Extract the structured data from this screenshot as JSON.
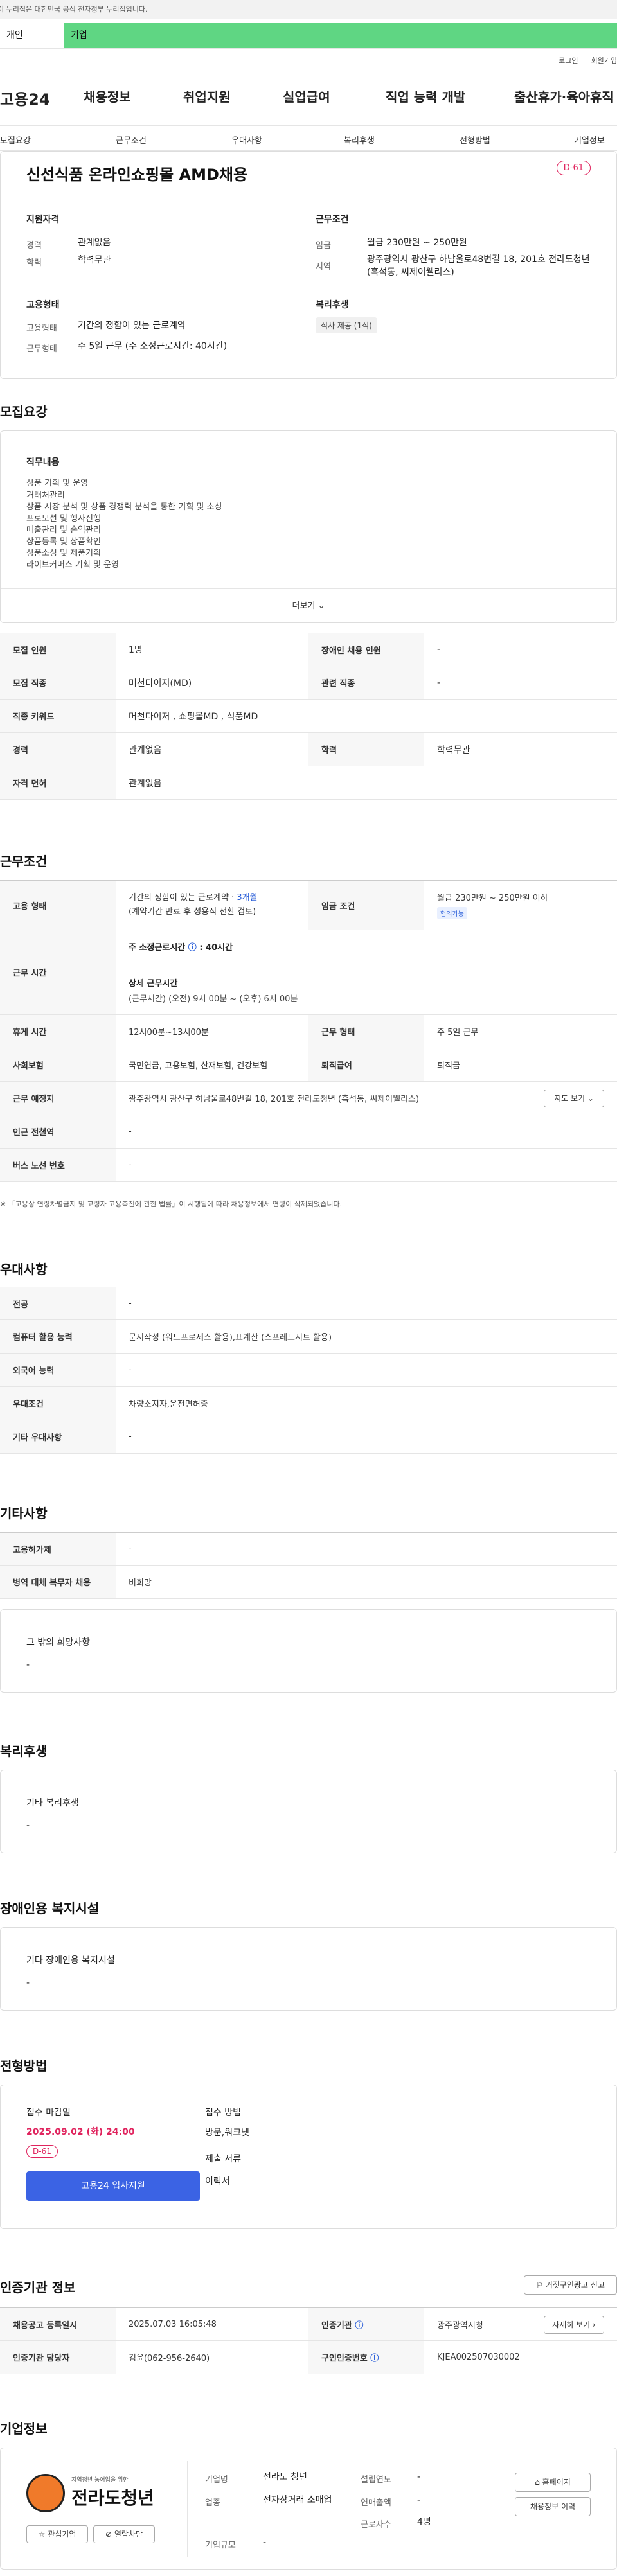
{
  "gov_banner": "이 누리집은 대한민국 공식 전자정부 누리집입니다.",
  "top_tabs": [
    "개인",
    "기업"
  ],
  "util": [
    "로그인",
    "회원가입"
  ],
  "gnb": [
    "고용24",
    "채용정보",
    "취업지원",
    "실업급여",
    "직업 능력 개발",
    "출산휴가·육아휴직"
  ],
  "lnb": [
    "모집요강",
    "근무조건",
    "우대사항",
    "복리후생",
    "전형방법",
    "기업정보"
  ],
  "job": {
    "title": "신선식품 온라인쇼핑몰 AMD채용",
    "dday": "D-61",
    "qual_label": "지원자격",
    "career_k": "경력",
    "career_v": "관계없음",
    "edu_k": "학력",
    "edu_v": "학력무관",
    "cond_label": "근무조건",
    "wage_k": "임금",
    "wage_v": "월급 230만원 ~ 250만원",
    "area_k": "지역",
    "area_v": "광주광역시 광산구 하남울로48번길 18, 201호 전라도청년 (흑석동, 씨제이웰리스)",
    "type_label": "고용형태",
    "emp_k": "고용형태",
    "emp_v": "기간의 정함이 있는 근로계약",
    "work_k": "근무형태",
    "work_v": "주 5일 근무 (주 소정근로시간: 40시간)",
    "welfare_label": "복리후생",
    "welfare_chip": "식사 제공 (1식)"
  },
  "recruit": {
    "heading": "모집요강",
    "duty_label": "직무내용",
    "duties": [
      "상품 기획 및 운영",
      "거래처관리",
      "상품 시장 분석 및 상품 경쟁력 분석을 통한 기획 및 소싱",
      "프로모션 및 행사진행",
      "매출관리 및 손익관리",
      "상품등록 및 상품확인",
      "상품소싱 및 제품기획",
      "라이브커머스 기획 및 운영"
    ],
    "more": "더보기",
    "rows": [
      [
        "모집 인원",
        "1명",
        "장애인 채용 인원",
        "-"
      ],
      [
        "모집 직종",
        "머천다이저(MD)",
        "관련 직종",
        "-"
      ],
      [
        "직종 키워드",
        "머천다이저 , 쇼핑몰MD , 식품MD",
        "",
        ""
      ],
      [
        "경력",
        "관계없음",
        "학력",
        "학력무관"
      ],
      [
        "자격 면허",
        "관계없음",
        "",
        ""
      ]
    ]
  },
  "cond": {
    "heading": "근무조건",
    "emp_th": "고용 형태",
    "emp_v1": "기간의 정함이 있는 근로계약 · ",
    "emp_month": "3개월",
    "emp_v2": "(계약기간 만료 후 성용직 전환 검토)",
    "wage_th": "임금 조건",
    "wage_v": "월급 230만원 ~ 250만원 이하",
    "wage_tag": "협의가능",
    "time_th": "근무 시간",
    "time_v1": "주 소정근로시간",
    "time_v1b": ": 40시간",
    "time_v2": "상세 근무시간",
    "time_v3": "(근무시간) (오전) 9시 00분 ~ (오후) 6시 00분",
    "rest_th": "휴게 시간",
    "rest_v": "12시00분~13시00분",
    "shift_th": "근무 형태",
    "shift_v": "주 5일 근무",
    "ins_th": "사회보험",
    "ins_v": "국민연금, 고용보험, 산재보험, 건강보험",
    "sev_th": "퇴직급여",
    "sev_v": "퇴직금",
    "place_th": "근무 예정지",
    "place_v": "광주광역시 광산구 하남울로48번길 18, 201호 전라도청년 (흑석동, 씨제이웰리스)",
    "map_btn": "지도 보기",
    "sub_th": "인근 전철역",
    "sub_v": "-",
    "bus_th": "버스 노선 번호",
    "bus_v": "-",
    "note": "※ 「고용상 연령차별금지 및 고령자 고용촉진에 관한 법률」이 시행됨에 따라 채용정보에서 연령이 삭제되었습니다."
  },
  "pref": {
    "heading": "우대사항",
    "rows": [
      [
        "전공",
        "-"
      ],
      [
        "컴퓨터 활용 능력",
        "문서작성 (워드프로세스 활용),표계산 (스프레드시트 활용)"
      ],
      [
        "외국어 능력",
        "-"
      ],
      [
        "우대조건",
        "차량소지자,운전면허증"
      ],
      [
        "기타 우대사항",
        "-"
      ]
    ]
  },
  "etc": {
    "heading": "기타사항",
    "rows": [
      [
        "고용허가제",
        "-"
      ],
      [
        "병역 대체 복무자 채용",
        "비희망"
      ]
    ],
    "box_label": "그 밖의 희망사항",
    "box_v": "-"
  },
  "welfare": {
    "heading": "복리후생",
    "label": "기타 복리후생",
    "v": "-"
  },
  "disab": {
    "heading": "장애인용 복지시설",
    "label": "기타 장애인용 복지시설",
    "v": "-"
  },
  "proc": {
    "heading": "전형방법",
    "deadline_label": "접수 마감일",
    "deadline": "2025.09.02 (화) 24:00",
    "dday": "D-61",
    "apply_btn": "고용24 입사지원",
    "method_label": "접수 방법",
    "method": "방문,워크넷",
    "docs_label": "제출 서류",
    "docs": "이력서"
  },
  "cert": {
    "heading": "인증기관 정보",
    "report_btn": "거짓구인광고 신고",
    "r1": [
      "채용공고 등록일시",
      "2025.07.03 16:05:48",
      "인증기관",
      "광주광역시청"
    ],
    "r2": [
      "인증기관 담당자",
      "김윤(062-956-2640)",
      "구인인증번호",
      "KJEA002507030002"
    ],
    "detail_btn": "자세히 보기"
  },
  "company": {
    "heading": "기업정보",
    "logo_text": "전라도청년",
    "logo_sub": "지역청년 농어업을 위한",
    "interest_btn": "관심기업",
    "block_btn": "열람차단",
    "name_k": "기업명",
    "name_v": "전라도 청년",
    "ind_k": "업종",
    "ind_v": "전자상거래 소매업",
    "size_k": "기업규모",
    "size_v": "-",
    "year_k": "설립연도",
    "year_v": "-",
    "sales_k": "연매출액",
    "sales_v": "-",
    "emp_k": "근로자수",
    "emp_v": "4명",
    "home_btn": "홈페이지",
    "jobs_btn": "채용정보 이력"
  },
  "colors": {
    "accent": "#2b5fd9",
    "green": "#5fd683",
    "dday": "#e0245e"
  }
}
